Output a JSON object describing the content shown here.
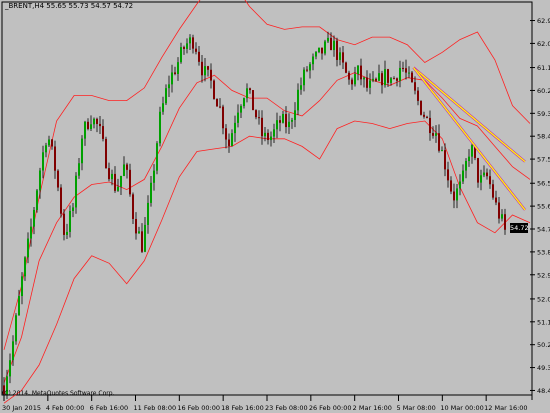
{
  "chart_header": {
    "symbol": "_BRENT,H4",
    "ohlc": "55.65 55.73 54.57 54.72"
  },
  "copyright_text": "(C) 2014, MetaQuotes Software Corp.",
  "current_price_label": "54.72",
  "colors": {
    "background": "#c0c0c0",
    "candle_up": "#00a000",
    "candle_down": "#800000",
    "bollinger": "#ff2020",
    "trendline": "#ffff00",
    "trendline_outline": "#c000c0"
  },
  "chart_data": {
    "type": "candlestick",
    "symbol": "BRENT",
    "timeframe": "H4",
    "ylim": [
      48.3,
      63.6
    ],
    "y_ticks": [
      "62.95",
      "62.05",
      "61.10",
      "60.20",
      "59.30",
      "58.40",
      "57.50",
      "56.55",
      "55.65",
      "54.75",
      "53.85",
      "52.95",
      "52.00",
      "51.10",
      "50.20",
      "49.30",
      "48.40"
    ],
    "x_ticks": [
      "30 Jan 2015",
      "4 Feb 00:00",
      "6 Feb 16:00",
      "11 Feb 08:00",
      "16 Feb 00:00",
      "18 Feb 16:00",
      "23 Feb 08:00",
      "26 Feb 00:00",
      "2 Mar 16:00",
      "5 Mar 08:00",
      "10 Mar 00:00",
      "12 Mar 16:00"
    ],
    "close_path": [
      48.6,
      50.2,
      52.6,
      54.5,
      56.8,
      58.6,
      57.0,
      54.5,
      55.6,
      58.4,
      59.2,
      58.7,
      57.2,
      56.3,
      57.3,
      55.2,
      54.1,
      56.2,
      59.0,
      60.5,
      61.2,
      62.0,
      62.2,
      61.0,
      60.5,
      59.5,
      58.0,
      59.5,
      60.3,
      59.4,
      58.3,
      58.4,
      59.0,
      58.8,
      60.1,
      61.0,
      61.4,
      61.8,
      62.1,
      61.3,
      60.5,
      60.9,
      60.3,
      60.4,
      60.8,
      60.6,
      61.2,
      60.5,
      59.7,
      59.0,
      58.6,
      57.4,
      56.0,
      56.5,
      58.1,
      56.6,
      56.8,
      55.6,
      54.72
    ],
    "bollinger": {
      "upper": [
        50.0,
        52.5,
        56.0,
        59.0,
        60.0,
        60.0,
        59.8,
        59.8,
        60.3,
        61.5,
        62.6,
        63.6,
        64.5,
        64.5,
        63.5,
        62.8,
        62.6,
        62.7,
        62.7,
        62.2,
        62.0,
        62.3,
        62.3,
        62.0,
        61.3,
        61.7,
        62.2,
        62.5,
        61.4,
        59.6,
        58.9
      ],
      "middle": [
        48.7,
        50.5,
        53.5,
        55.0,
        56.0,
        56.5,
        56.6,
        56.3,
        56.7,
        58.0,
        59.5,
        60.5,
        60.8,
        60.2,
        59.9,
        59.9,
        59.4,
        59.2,
        59.8,
        60.6,
        60.9,
        60.6,
        60.4,
        60.7,
        60.6,
        59.9,
        59.1,
        58.8,
        58.0,
        57.2,
        56.7
      ],
      "lower": [
        47.9,
        48.4,
        49.4,
        51.0,
        52.8,
        53.7,
        53.4,
        52.6,
        53.5,
        55.1,
        56.8,
        57.8,
        57.9,
        58.0,
        58.4,
        58.3,
        58.3,
        58.0,
        57.5,
        58.7,
        59.0,
        58.9,
        58.7,
        58.9,
        59.0,
        58.3,
        56.4,
        55.0,
        54.6,
        55.3,
        55.0
      ]
    },
    "trendlines": [
      {
        "from": [
          "5 Mar",
          61.1
        ],
        "to": [
          "12 Mar 16:00",
          57.4
        ]
      },
      {
        "from": [
          "5 Mar",
          61.1
        ],
        "to": [
          "12 Mar 16:00",
          55.5
        ]
      }
    ],
    "last_price": 54.72,
    "grid": false
  }
}
